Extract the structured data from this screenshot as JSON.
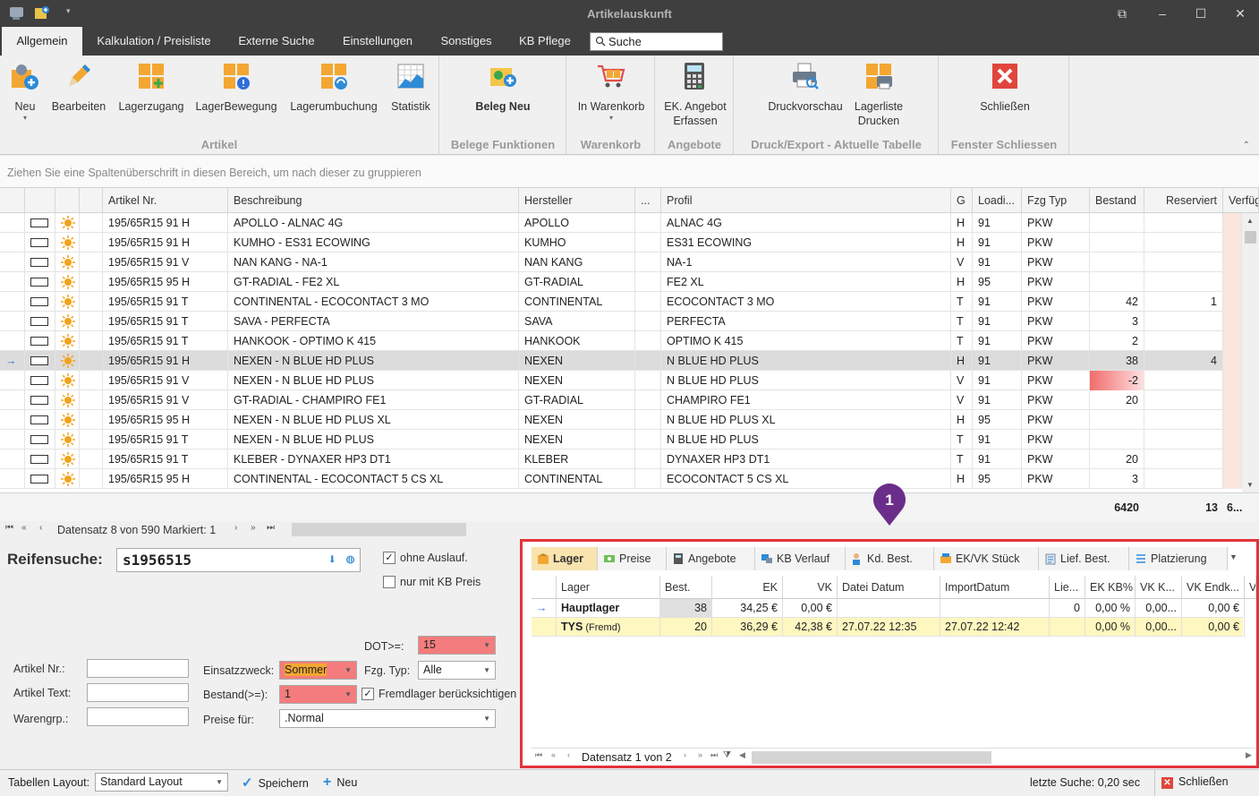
{
  "window": {
    "title": "Artikelauskunft"
  },
  "tabs": [
    "Allgemein",
    "Kalkulation / Preisliste",
    "Externe Suche",
    "Einstellungen",
    "Sonstiges",
    "KB Pflege"
  ],
  "search": {
    "label": "Suche"
  },
  "ribbon": {
    "groups": [
      {
        "label": "Artikel",
        "buttons": [
          "Neu",
          "Bearbeiten",
          "Lagerzugang",
          "LagerBewegung",
          "Lagerumbuchung",
          "Statistik"
        ]
      },
      {
        "label": "Belege Funktionen",
        "buttons": [
          "Beleg Neu"
        ]
      },
      {
        "label": "Warenkorb",
        "buttons": [
          "In Warenkorb"
        ]
      },
      {
        "label": "Angebote",
        "buttons": [
          "EK. Angebot Erfassen"
        ]
      },
      {
        "label": "Druck/Export - Aktuelle Tabelle",
        "buttons": [
          "Druckvorschau",
          "Lagerliste Drucken"
        ]
      },
      {
        "label": "Fenster Schliessen",
        "buttons": [
          "Schließen"
        ]
      }
    ]
  },
  "group_hint": "Ziehen Sie eine Spaltenüberschrift in diesen Bereich, um nach dieser zu gruppieren",
  "grid": {
    "columns": [
      "Artikel Nr.",
      "Beschreibung",
      "Hersteller",
      "...",
      "Profil",
      "G",
      "Loadi...",
      "Fzg Typ",
      "Bestand",
      "Reserviert",
      "Verfüg"
    ],
    "rows": [
      {
        "artikel": "195/65R15 91 H",
        "beschreibung": "APOLLO - ALNAC 4G",
        "hersteller": "APOLLO",
        "profil": "ALNAC 4G",
        "g": "H",
        "load": "91",
        "fzg": "PKW",
        "bestand": "",
        "reserviert": ""
      },
      {
        "artikel": "195/65R15 91 H",
        "beschreibung": "KUMHO - ES31 ECOWING",
        "hersteller": "KUMHO",
        "profil": "ES31 ECOWING",
        "g": "H",
        "load": "91",
        "fzg": "PKW",
        "bestand": "",
        "reserviert": ""
      },
      {
        "artikel": "195/65R15 91 V",
        "beschreibung": "NAN KANG - NA-1",
        "hersteller": "NAN KANG",
        "profil": "NA-1",
        "g": "V",
        "load": "91",
        "fzg": "PKW",
        "bestand": "",
        "reserviert": ""
      },
      {
        "artikel": "195/65R15 95 H",
        "beschreibung": "GT-RADIAL - FE2 XL",
        "hersteller": "GT-RADIAL",
        "profil": "FE2 XL",
        "g": "H",
        "load": "95",
        "fzg": "PKW",
        "bestand": "",
        "reserviert": ""
      },
      {
        "artikel": "195/65R15 91 T",
        "beschreibung": "CONTINENTAL - ECOCONTACT 3 MO",
        "hersteller": "CONTINENTAL",
        "profil": "ECOCONTACT 3 MO",
        "g": "T",
        "load": "91",
        "fzg": "PKW",
        "bestand": "42",
        "reserviert": "1"
      },
      {
        "artikel": "195/65R15 91 T",
        "beschreibung": "SAVA - PERFECTA",
        "hersteller": "SAVA",
        "profil": "PERFECTA",
        "g": "T",
        "load": "91",
        "fzg": "PKW",
        "bestand": "3",
        "reserviert": ""
      },
      {
        "artikel": "195/65R15 91 T",
        "beschreibung": "HANKOOK - OPTIMO K 415",
        "hersteller": "HANKOOK",
        "profil": "OPTIMO K 415",
        "g": "T",
        "load": "91",
        "fzg": "PKW",
        "bestand": "2",
        "reserviert": ""
      },
      {
        "artikel": "195/65R15 91 H",
        "beschreibung": "NEXEN - N BLUE HD PLUS",
        "hersteller": "NEXEN",
        "profil": "N BLUE HD PLUS",
        "g": "H",
        "load": "91",
        "fzg": "PKW",
        "bestand": "38",
        "reserviert": "4"
      },
      {
        "artikel": "195/65R15 91 V",
        "beschreibung": "NEXEN - N BLUE HD PLUS",
        "hersteller": "NEXEN",
        "profil": "N BLUE HD PLUS",
        "g": "V",
        "load": "91",
        "fzg": "PKW",
        "bestand": "-2",
        "reserviert": ""
      },
      {
        "artikel": "195/65R15 91 V",
        "beschreibung": "GT-RADIAL - CHAMPIRO FE1",
        "hersteller": "GT-RADIAL",
        "profil": "CHAMPIRO FE1",
        "g": "V",
        "load": "91",
        "fzg": "PKW",
        "bestand": "20",
        "reserviert": ""
      },
      {
        "artikel": "195/65R15 95 H",
        "beschreibung": "NEXEN - N BLUE HD PLUS XL",
        "hersteller": "NEXEN",
        "profil": "N BLUE HD PLUS XL",
        "g": "H",
        "load": "95",
        "fzg": "PKW",
        "bestand": "",
        "reserviert": ""
      },
      {
        "artikel": "195/65R15 91 T",
        "beschreibung": "NEXEN - N BLUE HD PLUS",
        "hersteller": "NEXEN",
        "profil": "N BLUE HD PLUS",
        "g": "T",
        "load": "91",
        "fzg": "PKW",
        "bestand": "",
        "reserviert": ""
      },
      {
        "artikel": "195/65R15 91 T",
        "beschreibung": "KLEBER - DYNAXER HP3 DT1",
        "hersteller": "KLEBER",
        "profil": "DYNAXER HP3 DT1",
        "g": "T",
        "load": "91",
        "fzg": "PKW",
        "bestand": "20",
        "reserviert": ""
      },
      {
        "artikel": "195/65R15 95 H",
        "beschreibung": "CONTINENTAL - ECOCONTACT 5 CS XL",
        "hersteller": "CONTINENTAL",
        "profil": "ECOCONTACT 5 CS XL",
        "g": "H",
        "load": "95",
        "fzg": "PKW",
        "bestand": "3",
        "reserviert": ""
      }
    ],
    "totals": {
      "bestand": "6420",
      "reserviert": "13",
      "verfuegbar": "6..."
    }
  },
  "nav1": {
    "text": "Datensatz 8 von 590 Markiert: 1"
  },
  "reifensuche": {
    "label": "Reifensuche:",
    "value": "s1956515",
    "ohne_auslauf": "ohne Auslauf.",
    "nur_kb_preis": "nur mit KB Preis",
    "dot_label": "DOT>=:",
    "dot_value": "15",
    "artikel_nr_label": "Artikel Nr.:",
    "artikel_text_label": "Artikel Text:",
    "warengrp_label": "Warengrp.:",
    "einsatz_label": "Einsatzzweck:",
    "einsatz_value": "Sommer",
    "fzg_label": "Fzg. Typ:",
    "fzg_value": "Alle",
    "bestand_label": "Bestand(>=):",
    "bestand_value": "1",
    "fremdlager": "Fremdlager berücksichtigen",
    "preise_label": "Preise für:",
    "preise_value": ".Normal"
  },
  "detail": {
    "tabs": [
      "Lager",
      "Preise",
      "Angebote",
      "KB Verlauf",
      "Kd. Best.",
      "EK/VK Stück",
      "Lief. Best.",
      "Platzierung"
    ],
    "columns": [
      "Lager",
      "Best.",
      "EK",
      "VK",
      "Datei Datum",
      "ImportDatum",
      "Lie...",
      "EK KB%",
      "VK K...",
      "VK Endk...",
      "V"
    ],
    "rows": [
      {
        "lager": "Hauptlager",
        "sub": "",
        "best": "38",
        "ek": "34,25 €",
        "vk": "0,00 €",
        "datei": "",
        "import": "",
        "lie": "0",
        "ekkb": "0,00 %",
        "vkk": "0,00...",
        "vkend": "0,00 €"
      },
      {
        "lager": "TYS",
        "sub": "(Fremd)",
        "best": "20",
        "ek": "36,29 €",
        "vk": "42,38 €",
        "datei": "27.07.22 12:35",
        "import": "27.07.22 12:42",
        "lie": "",
        "ekkb": "0,00 %",
        "vkk": "0,00...",
        "vkend": "0,00 €"
      }
    ],
    "nav": "Datensatz 1 von 2"
  },
  "badge": "1",
  "statusbar": {
    "layout_label": "Tabellen Layout:",
    "layout_value": "Standard Layout",
    "save": "Speichern",
    "new": "Neu",
    "last_search": "letzte Suche: 0,20 sec",
    "close": "Schließen"
  },
  "colors": {
    "accent_red": "#e3343a",
    "badge_purple": "#6b2d8a",
    "row_selected": "#dcdcdc",
    "highlight_yellow": "#fff7c0",
    "negative_stock": "#f26c6c"
  }
}
